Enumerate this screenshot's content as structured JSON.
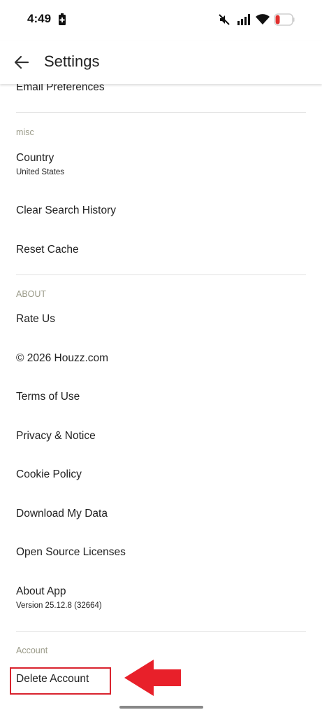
{
  "status_bar": {
    "time": "4:49",
    "icons": [
      "battery-saver-icon",
      "mute-icon",
      "signal-icon",
      "wifi-icon",
      "battery-icon"
    ]
  },
  "header": {
    "back_icon": "arrow-left-icon",
    "title": "Settings"
  },
  "settings": {
    "partial_item": "Email Preferences",
    "misc_header": "misc",
    "misc_items": [
      {
        "label": "Country",
        "sub": "United States"
      },
      {
        "label": "Clear Search History"
      },
      {
        "label": "Reset Cache"
      }
    ],
    "about_header": "ABOUT",
    "about_items": [
      {
        "label": "Rate Us"
      },
      {
        "label": "© 2026 Houzz.com"
      },
      {
        "label": "Terms of Use"
      },
      {
        "label": "Privacy & Notice"
      },
      {
        "label": "Cookie Policy"
      },
      {
        "label": "Download My Data"
      },
      {
        "label": "Open Source Licenses"
      },
      {
        "label": "About App",
        "sub": "Version 25.12.8 (32664)"
      }
    ],
    "account_header": "Account",
    "account_items": [
      {
        "label": "Delete Account"
      }
    ]
  },
  "colors": {
    "annotation": "#d9232e",
    "section_header": "#9a9a88"
  }
}
